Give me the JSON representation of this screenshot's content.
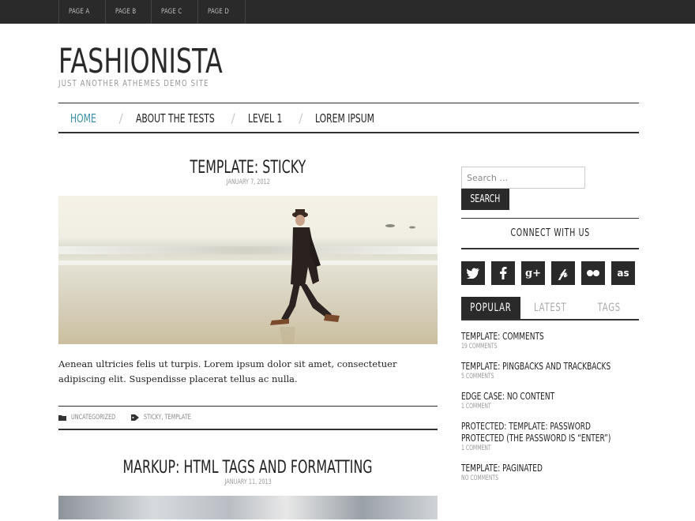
{
  "topbar": {
    "pages": [
      "PAGE A",
      "PAGE B",
      "PAGE C",
      "PAGE D"
    ]
  },
  "header": {
    "title": "FASHIONISTA",
    "description": "JUST ANOTHER ATHEMES DEMO SITE"
  },
  "nav": {
    "items": [
      "HOME",
      "ABOUT THE TESTS",
      "LEVEL 1",
      "LOREM IPSUM"
    ],
    "active": "HOME",
    "active_color": "#3a8fa6"
  },
  "posts": [
    {
      "title": "TEMPLATE: STICKY",
      "date": "JANUARY 7, 2012",
      "excerpt": "Aenean ultricies felis ut turpis. Lorem ipsum dolor sit amet, consectetuer adipiscing elit. Suspendisse placerat tellus ac nulla.",
      "category": "UNCATEGORIZED",
      "tags": "STICKY, TEMPLATE"
    },
    {
      "title": "MARKUP: HTML TAGS AND FORMATTING",
      "date": "JANUARY 11, 2013"
    }
  ],
  "sidebar": {
    "search_placeholder": "Search …",
    "search_button": "SEARCH",
    "connect_title": "CONNECT WITH US",
    "socials": [
      "twitter-icon",
      "facebook-icon",
      "google-plus-icon",
      "pinterest-icon",
      "flickr-icon",
      "lastfm-icon"
    ],
    "tabs": [
      "POPULAR",
      "LATEST",
      "TAGS"
    ],
    "popular": [
      {
        "title": "TEMPLATE: COMMENTS",
        "count": "19 COMMENTS"
      },
      {
        "title": "TEMPLATE: PINGBACKS AND TRACKBACKS",
        "count": "5 COMMENTS"
      },
      {
        "title": "EDGE CASE: NO CONTENT",
        "count": "1 COMMENT"
      },
      {
        "title": "PROTECTED: TEMPLATE: PASSWORD PROTECTED (THE PASSWORD IS “ENTER”)",
        "count": "1 COMMENT"
      },
      {
        "title": "TEMPLATE: PAGINATED",
        "count": "NO COMMENTS"
      }
    ]
  }
}
